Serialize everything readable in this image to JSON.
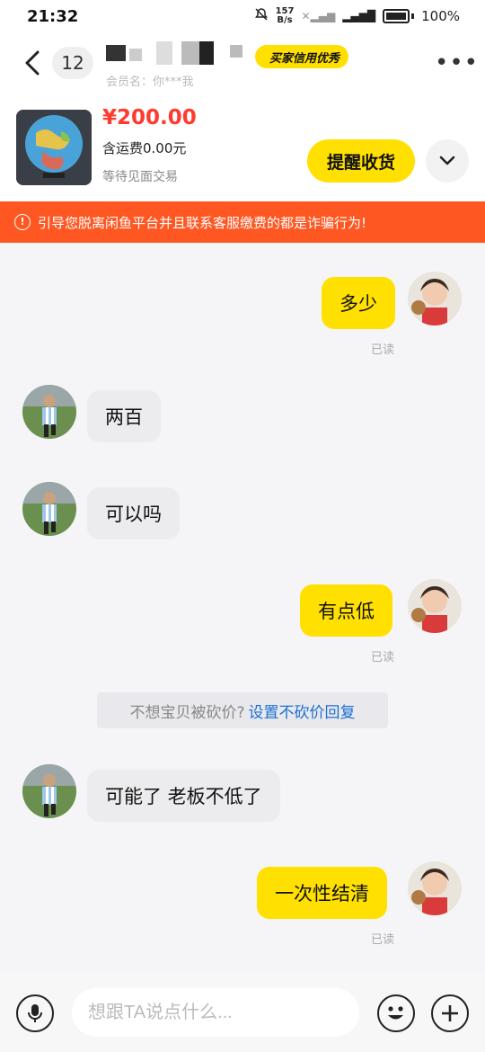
{
  "status_bar": {
    "time": "21:32",
    "net_speed_value": "157",
    "net_speed_unit": "B/s",
    "battery": "100%"
  },
  "header": {
    "back_icon": "chevron-left-icon",
    "unread_count": "12",
    "seller_name": "",
    "credit_badge": "买家信用优秀",
    "member_line": "会员名：你***我",
    "more_icon": "more-dots-icon"
  },
  "item": {
    "price": "¥200.00",
    "shipping": "含运费0.00元",
    "status": "等待见面交易",
    "remind_button": "提醒收货",
    "expand_icon": "chevron-down-icon"
  },
  "warning": {
    "icon": "warning-circle-icon",
    "text": "引导您脱离闲鱼平台并且联系客服缴费的都是诈骗行为!"
  },
  "messages": [
    {
      "from": "me",
      "text": "多少",
      "status": "已读"
    },
    {
      "from": "them",
      "text": "两百"
    },
    {
      "from": "them",
      "text": "可以吗"
    },
    {
      "from": "me",
      "text": "有点低",
      "status": "已读"
    },
    {
      "from": "them",
      "text": "可能了 老板不低了"
    },
    {
      "from": "me",
      "text": "一次性结清",
      "status": "已读"
    }
  ],
  "bargain_notice": {
    "text": "不想宝贝被砍价?",
    "link": "设置不砍价回复"
  },
  "input_bar": {
    "placeholder": "想跟TA说点什么...",
    "mic_icon": "microphone-icon",
    "emoji_icon": "smiley-icon",
    "plus_icon": "plus-icon"
  },
  "colors": {
    "accent_yellow": "#ffe000",
    "price_red": "#ff3b30",
    "warning_orange": "#ff5722",
    "link_blue": "#1c6fd1"
  }
}
